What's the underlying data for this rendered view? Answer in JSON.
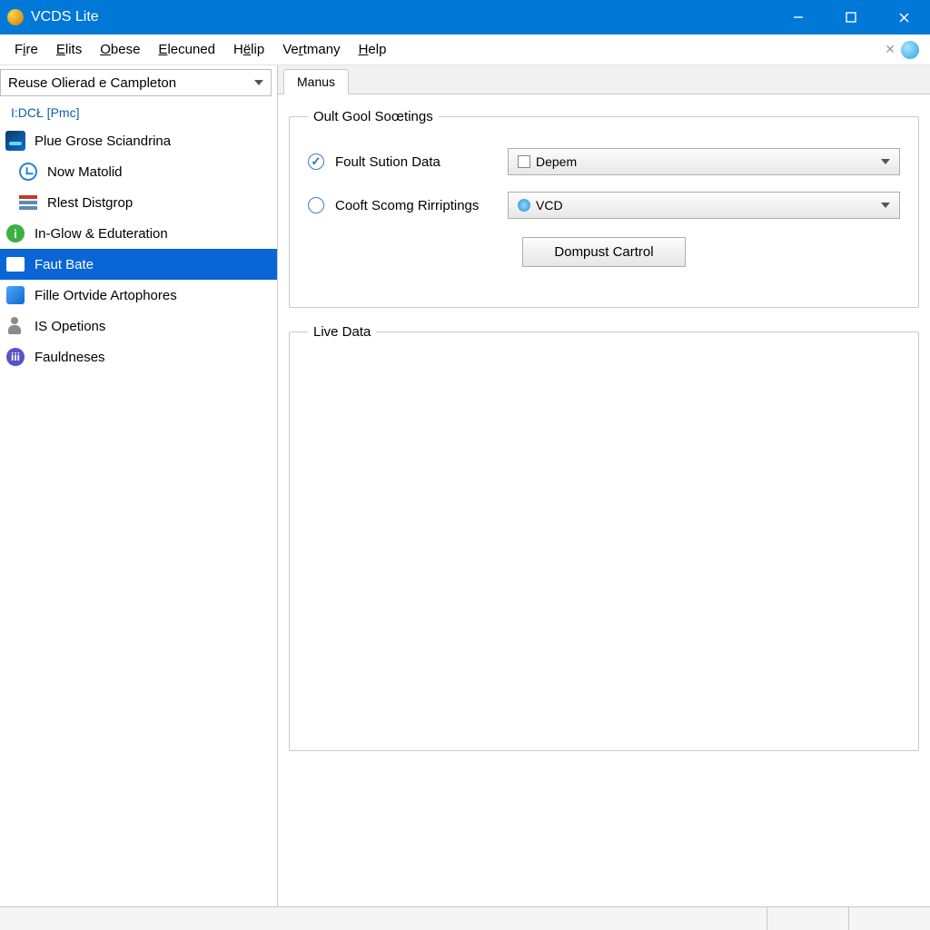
{
  "window": {
    "title": "VCDS Lite"
  },
  "menu": {
    "items": [
      {
        "pre": "F",
        "ul": "i",
        "post": "re"
      },
      {
        "pre": "",
        "ul": "E",
        "post": "lits"
      },
      {
        "pre": "",
        "ul": "O",
        "post": "bese"
      },
      {
        "pre": "",
        "ul": "E",
        "post": "lecuned"
      },
      {
        "pre": "H",
        "ul": "ë",
        "post": "lip"
      },
      {
        "pre": "Ve",
        "ul": "r",
        "post": "tmany"
      },
      {
        "pre": "",
        "ul": "H",
        "post": "elp"
      }
    ]
  },
  "sidebar": {
    "combo_value": "Reuse Olierad e Campleton",
    "header": "I:DCŁ  [Pmc]",
    "items": [
      {
        "label": "Plue Grose Sciandrina"
      },
      {
        "label": "Now Matolid"
      },
      {
        "label": "Rlest Distgrop"
      },
      {
        "label": "In-Glow & Eduteration"
      },
      {
        "label": "Faut Bate"
      },
      {
        "label": "Fille Ortvide Artophores"
      },
      {
        "label": "IS Opetions"
      },
      {
        "label": "Fauldneses"
      }
    ]
  },
  "tabs": {
    "active": "Manus"
  },
  "settings": {
    "legend": "Oult Gool Soœtings",
    "opt1_label": "Foult Sution Data",
    "opt2_label": "Cooft Scomg Rirriptings",
    "dd1_value": "Depem",
    "dd2_value": "VCD",
    "button": "Dompust Cartrol"
  },
  "live": {
    "legend": "Live Data"
  }
}
